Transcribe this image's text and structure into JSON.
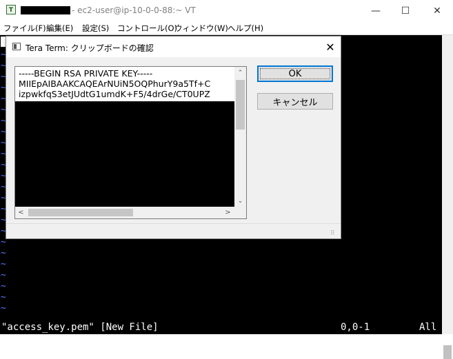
{
  "window": {
    "title": "- ec2-user@ip-10-0-0-88:~ VT",
    "icon_label": "T",
    "controls": {
      "minimize": "—",
      "maximize": "☐",
      "close": "✕"
    }
  },
  "menu": [
    "ファイル(F)",
    "編集(E)",
    "設定(S)",
    "コントロール(O)",
    "ウィンドウ(W)",
    "ヘルプ(H)"
  ],
  "terminal": {
    "tilde_char": "~",
    "status": {
      "file": "\"access_key.pem\" [New File]",
      "position": "0,0-1",
      "scroll": "All"
    }
  },
  "dialog": {
    "title": "Tera Term: クリップボードの確認",
    "close": "✕",
    "clipboard_lines": [
      "-----BEGIN RSA PRIVATE KEY-----",
      "MIIEpAIBAAKCAQEArNUiN5OQPhurY9a5Tf+C",
      "izpwkfqS3etJUdtG1umdK+F5/4drGe/CT0UPZ"
    ],
    "scroll_up": "⌃",
    "scroll_down": "⌄",
    "scroll_left": "<",
    "scroll_right": ">",
    "ok_label": "OK",
    "cancel_label": "キャンセル",
    "grip": "⠿"
  }
}
